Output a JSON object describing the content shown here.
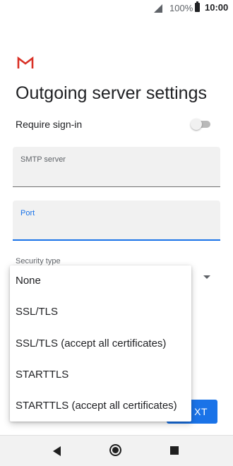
{
  "status_bar": {
    "battery_percent": "100%",
    "time": "10:00",
    "signal_icon": "signal-icon",
    "battery_icon": "battery-icon"
  },
  "app": {
    "logo_icon": "gmail-icon"
  },
  "page": {
    "title": "Outgoing server settings"
  },
  "form": {
    "require_signin_label": "Require sign-in",
    "require_signin_on": false,
    "smtp_server_label": "SMTP server",
    "smtp_server_value": "",
    "port_label": "Port",
    "port_value": "",
    "security_type_label": "Security type"
  },
  "security_menu": {
    "options": [
      "None",
      "SSL/TLS",
      "SSL/TLS (accept all certificates)",
      "STARTTLS",
      "STARTTLS (accept all certificates)"
    ]
  },
  "buttons": {
    "next_visible_label": "XT"
  },
  "nav_bar": {
    "back_icon": "back-icon",
    "home_icon": "home-icon",
    "recents_icon": "recents-icon"
  },
  "colors": {
    "accent": "#1a73e8",
    "gmail_red": "#d93025",
    "field_background": "#f1f1f1"
  }
}
